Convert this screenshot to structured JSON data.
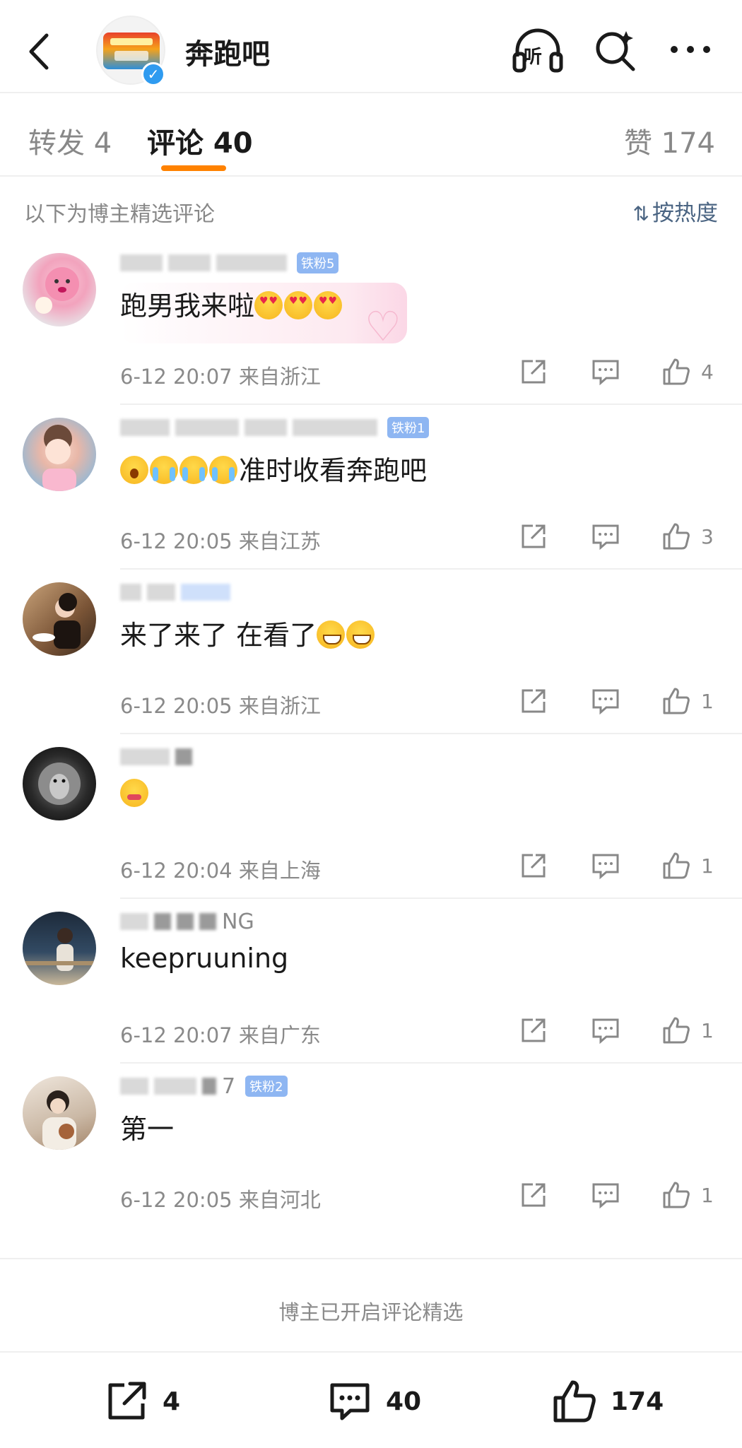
{
  "header": {
    "title": "奔跑吧",
    "listen_label": "听",
    "logo_icon": "variety-show-logo",
    "verified_mark": "✓"
  },
  "tabs": {
    "repost": "转发 4",
    "comment": "评论 40",
    "like": "赞 174"
  },
  "filter": {
    "label": "以下为博主精选评论",
    "sort_label": "按热度"
  },
  "comments": [
    {
      "avatar": "pink-cartoon-avatar",
      "badge": "铁粉5",
      "username_suffix": "",
      "text": "跑男我来啦",
      "emojis": [
        "heart-eyes",
        "heart-eyes",
        "heart-eyes"
      ],
      "emoji_position": "after",
      "time": "6-12 20:07",
      "location": "来自浙江",
      "likes": "4"
    },
    {
      "avatar": "girl-portrait-avatar",
      "badge": "铁粉1",
      "username_suffix": "",
      "text": "准时收看奔跑吧",
      "emojis": [
        "shock",
        "cry",
        "cry",
        "cry"
      ],
      "emoji_position": "before",
      "time": "6-12 20:05",
      "location": "来自江苏",
      "likes": "3"
    },
    {
      "avatar": "woman-dining-avatar",
      "badge": "",
      "username_suffix": "",
      "text": "来了来了 在看了",
      "emojis": [
        "grin",
        "grin"
      ],
      "emoji_position": "after",
      "time": "6-12 20:05",
      "location": "来自浙江",
      "likes": "1"
    },
    {
      "avatar": "lion-avatar",
      "badge": "",
      "username_suffix": "",
      "text": "",
      "emojis": [
        "drool"
      ],
      "emoji_position": "after",
      "time": "6-12 20:04",
      "location": "来自上海",
      "likes": "1"
    },
    {
      "avatar": "man-night-avatar",
      "badge": "",
      "username_suffix": "NG",
      "text": "keepruuning",
      "emojis": [],
      "emoji_position": "after",
      "time": "6-12 20:07",
      "location": "来自广东",
      "likes": "1"
    },
    {
      "avatar": "woman-with-dog-avatar",
      "badge": "铁粉2",
      "username_suffix": "7",
      "text": "第一",
      "emojis": [],
      "emoji_position": "after",
      "time": "6-12 20:05",
      "location": "来自河北",
      "likes": "1"
    }
  ],
  "notice": "博主已开启评论精选",
  "bottom_bar": {
    "repost_count": "4",
    "comment_count": "40",
    "like_count": "174"
  },
  "colors": {
    "accent": "#ff8200",
    "link": "#4a6482",
    "muted": "#8a8a8a",
    "badge": "#8eb6f2",
    "verified": "#2f9bf0"
  }
}
